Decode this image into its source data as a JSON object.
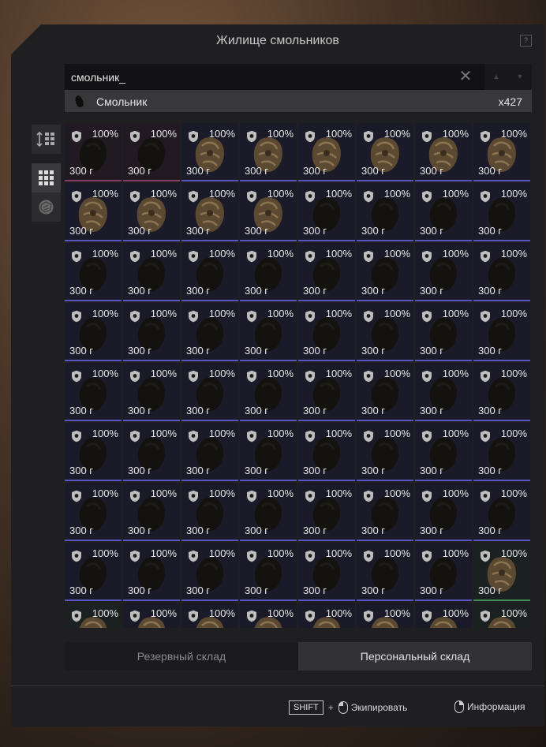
{
  "window": {
    "title": "Жилище смольников",
    "help_label": "?"
  },
  "search": {
    "value": "смольник_",
    "placeholder": "",
    "clear_icon": "✕",
    "up_icon": "▲",
    "down_icon": "▼"
  },
  "result": {
    "name": "Смольник",
    "count": "x427"
  },
  "sidebar": {
    "items": [
      "sort-icon",
      "grid-view-icon",
      "item-type-icon"
    ]
  },
  "grid": {
    "columns": 8,
    "item": {
      "durability": "100%",
      "weight": "300 г",
      "icon": "shield-icon"
    },
    "rows": [
      [
        "pink",
        "pink",
        "blue",
        "blue",
        "blue",
        "blue",
        "blue",
        "blue"
      ],
      [
        "blue",
        "blue",
        "blue",
        "blue",
        "blue",
        "blue",
        "blue",
        "blue"
      ],
      [
        "blue",
        "blue",
        "blue",
        "blue",
        "blue",
        "blue",
        "blue",
        "blue"
      ],
      [
        "blue",
        "blue",
        "blue",
        "blue",
        "blue",
        "blue",
        "blue",
        "blue"
      ],
      [
        "blue",
        "blue",
        "blue",
        "blue",
        "blue",
        "blue",
        "blue",
        "blue"
      ],
      [
        "blue",
        "blue",
        "blue",
        "blue",
        "blue",
        "blue",
        "blue",
        "blue"
      ],
      [
        "blue",
        "blue",
        "blue",
        "blue",
        "blue",
        "blue",
        "blue",
        "blue"
      ],
      [
        "blue",
        "blue",
        "blue",
        "blue",
        "blue",
        "blue",
        "blue",
        "green"
      ],
      [
        "green",
        "blue",
        "blue",
        "blue",
        "blue",
        "blue",
        "blue",
        "green"
      ]
    ],
    "light_items": [
      [
        0,
        2
      ],
      [
        0,
        3
      ],
      [
        0,
        4
      ],
      [
        0,
        5
      ],
      [
        0,
        6
      ],
      [
        0,
        7
      ],
      [
        1,
        0
      ],
      [
        1,
        1
      ],
      [
        1,
        2
      ],
      [
        1,
        3
      ],
      [
        7,
        7
      ],
      [
        8,
        0
      ],
      [
        8,
        1
      ],
      [
        8,
        2
      ],
      [
        8,
        3
      ],
      [
        8,
        4
      ],
      [
        8,
        5
      ],
      [
        8,
        6
      ],
      [
        8,
        7
      ]
    ]
  },
  "tabs": {
    "reserve": "Резервный склад",
    "personal": "Персональный склад"
  },
  "footer": {
    "key_label": "SHIFT",
    "plus": "+",
    "equip_label": "Экипировать",
    "info_label": "Информация"
  },
  "colors": {
    "rarity_blue": "#5b55c4",
    "rarity_pink": "#8a3d66",
    "rarity_green": "#3f8f52"
  }
}
